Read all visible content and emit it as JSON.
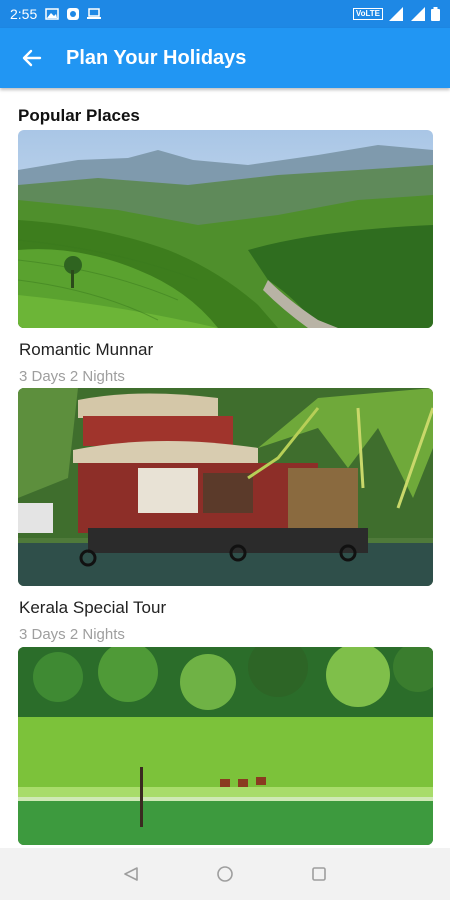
{
  "status_bar": {
    "time": "2:55",
    "network": "VoLTE",
    "signal": "4G"
  },
  "app_bar": {
    "title": "Plan Your Holidays"
  },
  "section": {
    "title": "Popular Places"
  },
  "packages": [
    {
      "name": "Romantic Munnar",
      "duration": "3 Days 2 Nights"
    },
    {
      "name": "Kerala Special Tour",
      "duration": "3 Days 2 Nights"
    }
  ],
  "colors": {
    "status_bar": "#1e88e5",
    "app_bar": "#2196f3"
  }
}
